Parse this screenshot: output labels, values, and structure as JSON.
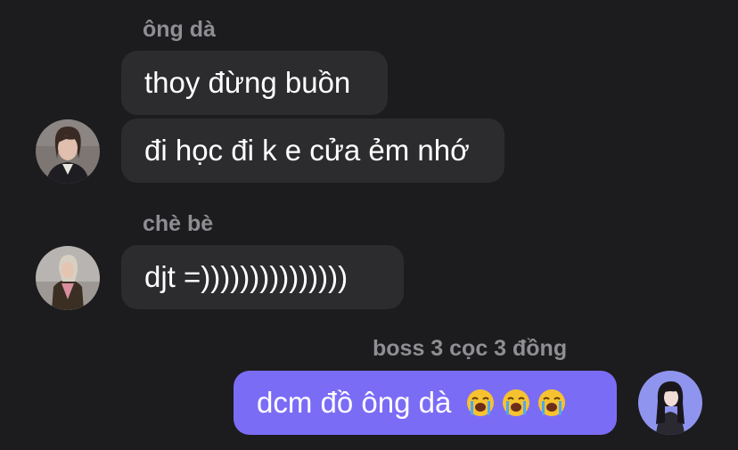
{
  "chat": {
    "groups": [
      {
        "sender": "ông dà",
        "messages": [
          "thoy đừng buồn",
          "đi học đi k e cửa ẻm nhớ"
        ],
        "avatar": "woman-portrait-avatar"
      },
      {
        "sender": "chè bè",
        "messages": [
          "djt =)))))))))))))))"
        ],
        "avatar": "girl-jacket-avatar"
      },
      {
        "sender": "boss 3 cọc 3 đồng",
        "messages": [
          {
            "text": "dcm đồ ông dà",
            "emojis": [
              "loudly-crying-face",
              "loudly-crying-face",
              "loudly-crying-face"
            ]
          }
        ],
        "avatar": "dark-hair-girl-avatar"
      }
    ]
  },
  "colors": {
    "background": "#1c1c1e",
    "incoming_bubble": "#2c2c2e",
    "outgoing_bubble": "#7b6cf6",
    "sender_name": "#8e8e93",
    "message_text": "#ffffff",
    "own_avatar_bg": "#8f95ef"
  }
}
